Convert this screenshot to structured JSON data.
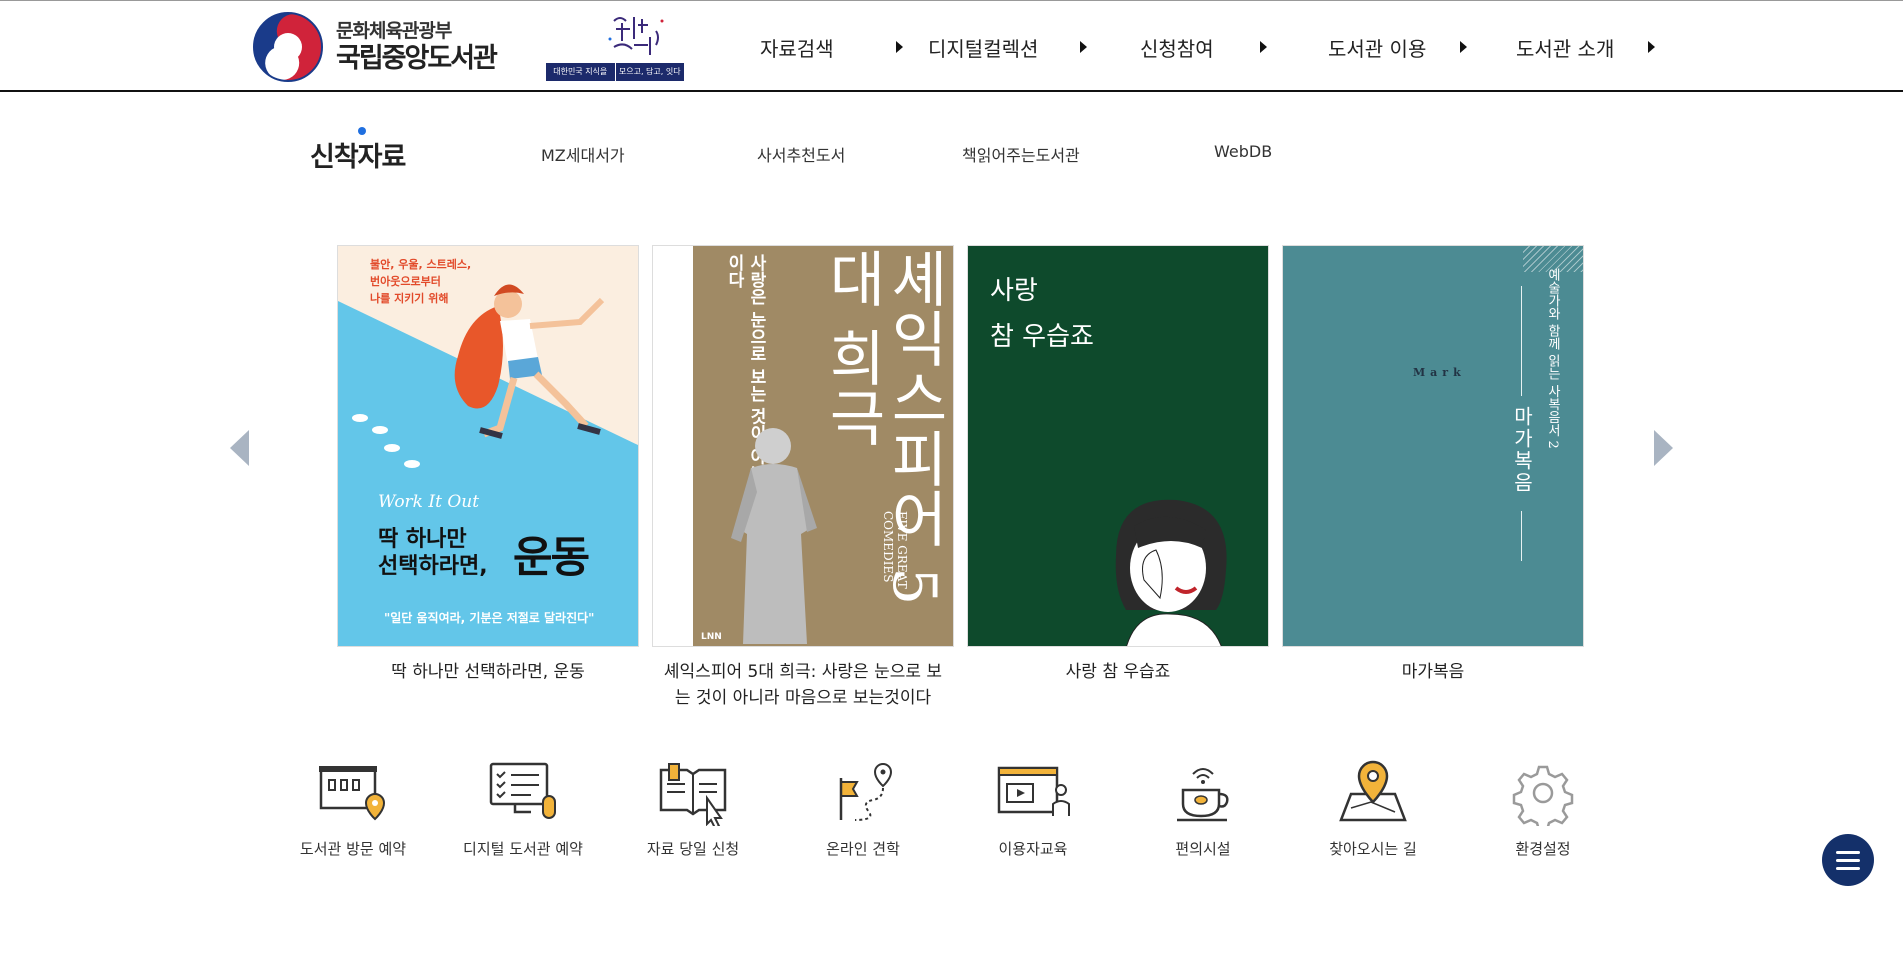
{
  "header": {
    "ministry": "문화체육관광부",
    "library": "국립중앙도서관",
    "banner_left": "대한민국 지식을",
    "banner_right": "모으고, 담고, 잇다",
    "nav": [
      "자료검색",
      "디지털컬렉션",
      "신청참여",
      "도서관 이용",
      "도서관 소개"
    ]
  },
  "tabs": {
    "active": "신착자료",
    "items": [
      "MZ세대서가",
      "사서추천도서",
      "책읽어주는도서관",
      "WebDB"
    ]
  },
  "books": [
    {
      "title": "딱 하나만 선택하라면, 운동",
      "cover": {
        "kicker": [
          "불안, 우울, 스트레스,",
          "번아웃으로부터",
          "나를 지키기 위해"
        ],
        "wave": "Work It Out",
        "big1": [
          "딱 하나만",
          "선택하라면,"
        ],
        "big2": "운동",
        "foot": "\"일단 움직여라, 기분은 저절로 달라진다\""
      }
    },
    {
      "title": "셰익스피어 5대 희극: 사랑은 눈으로 보는 것이 아니라 마음으로 보는것이다",
      "cover": {
        "big": "셰익스피어 5대 희극",
        "sub": "사랑은 눈으로 보는 것이 아니라 마음으로 보는 것이다",
        "eng": "FIVE GREAT COMEDIES",
        "pub": "LNN"
      }
    },
    {
      "title": "사랑 참 우습죠",
      "cover": {
        "line1": "사랑",
        "line2": "참 우습죠"
      }
    },
    {
      "title": "마가복음",
      "cover": {
        "mark": "Mark",
        "series": "예술가와 함께 읽는 사복음서 2",
        "title": "마가복음"
      }
    }
  ],
  "quick_links": [
    {
      "label": "도서관 방문 예약",
      "icon": "library-visit-icon"
    },
    {
      "label": "디지털 도서관 예약",
      "icon": "digital-library-icon"
    },
    {
      "label": "자료 당일 신청",
      "icon": "book-request-icon"
    },
    {
      "label": "온라인 견학",
      "icon": "online-tour-icon"
    },
    {
      "label": "이용자교육",
      "icon": "user-education-icon"
    },
    {
      "label": "편의시설",
      "icon": "cafe-icon"
    },
    {
      "label": "찾아오시는 길",
      "icon": "map-pin-icon"
    },
    {
      "label": "환경설정",
      "icon": "gear-icon"
    }
  ],
  "colors": {
    "accent": "#1f6fe0",
    "nav_dark": "#14306a",
    "icon_gold": "#f2b33a",
    "arrow": "#a9b4c2"
  }
}
